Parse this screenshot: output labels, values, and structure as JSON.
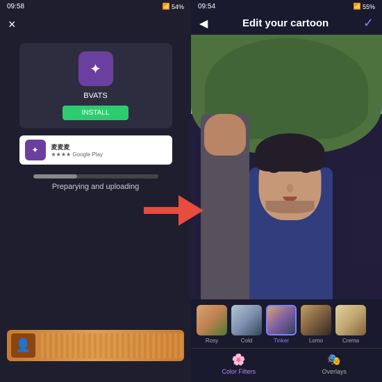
{
  "left_phone": {
    "status_time": "09:58",
    "status_icons": "◼ ⬛",
    "battery": "54%",
    "app_card": {
      "app_icon_label": "✦",
      "app_name": "BVATS",
      "install_label": "INSTALL"
    },
    "app_row": {
      "icon_label": "✦",
      "name": "麦麦麦",
      "sub": "★★★★ Google Play"
    },
    "progress_text": "Preparying and uploading",
    "close_label": "×"
  },
  "right_phone": {
    "status_time": "09:54",
    "battery": "55%",
    "header_title": "Edit your cartoon",
    "back_label": "◀",
    "check_label": "✓",
    "filters": [
      {
        "label": "Rosy",
        "active": false
      },
      {
        "label": "Cold",
        "active": false
      },
      {
        "label": "Tinker",
        "active": true
      },
      {
        "label": "Lomo",
        "active": false
      },
      {
        "label": "Crema",
        "active": false
      }
    ],
    "tabs": [
      {
        "label": "Color Filters",
        "icon": "🌸",
        "active": true
      },
      {
        "label": "Overlays",
        "icon": "🎭",
        "active": false
      }
    ]
  },
  "arrow": {
    "color": "#e74c3c"
  }
}
